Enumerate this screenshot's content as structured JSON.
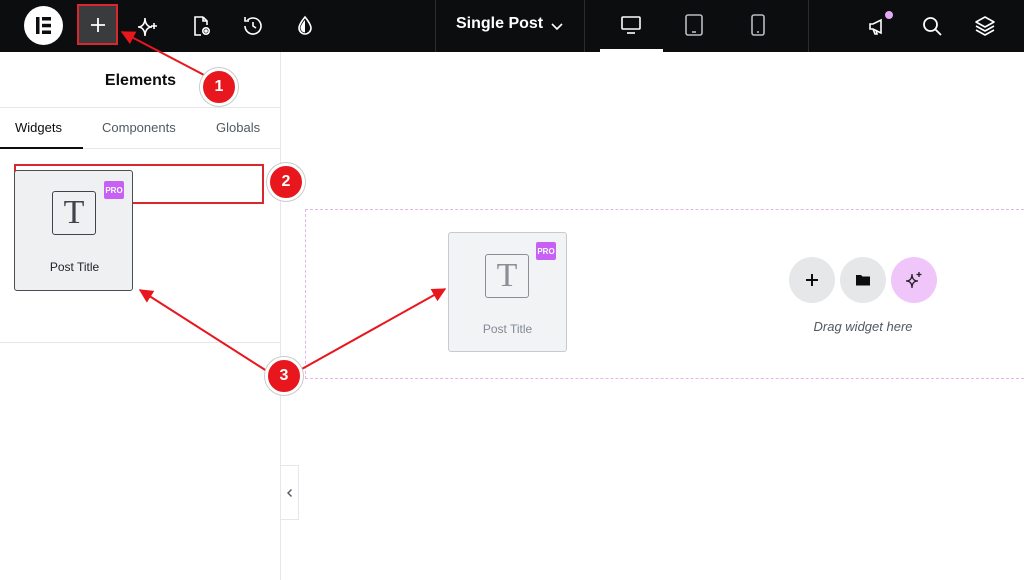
{
  "topbar": {
    "document_title": "Single Post",
    "icons": [
      "elementor-logo-icon",
      "plus-icon",
      "sparkle-ai-icon",
      "page-settings-icon",
      "history-icon",
      "theme-style-icon",
      "chevron-down-icon",
      "desktop-icon",
      "tablet-icon",
      "mobile-icon",
      "megaphone-icon",
      "search-icon",
      "layers-icon"
    ]
  },
  "panel": {
    "title": "Elements",
    "tabs": [
      {
        "label": "Widgets",
        "active": true
      },
      {
        "label": "Components",
        "active": false
      },
      {
        "label": "Globals",
        "active": false
      }
    ],
    "search": {
      "value": "",
      "placeholder": "Post Title"
    },
    "widget": {
      "label": "Post Title",
      "badge": "PRO"
    }
  },
  "canvas": {
    "ghost_widget": {
      "label": "Post Title",
      "badge": "PRO"
    },
    "drop_hint": "Drag widget here"
  },
  "annotations": [
    {
      "number": "1"
    },
    {
      "number": "2"
    },
    {
      "number": "3"
    }
  ],
  "colors": {
    "topbar_bg": "#0c0d0e",
    "annotation_red": "#e8161d",
    "pro_badge": "#c760f5",
    "container_dash": "#e6b4ea",
    "ai_button": "#f0c6fa"
  }
}
